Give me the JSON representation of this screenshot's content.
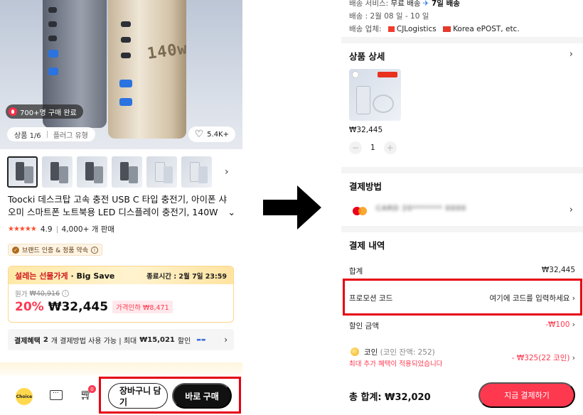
{
  "left": {
    "hero": {
      "brand_text": "140w",
      "sold_badge": "700+명 구매 완료",
      "image_counter": "상품 1/6",
      "variant_tag": "플러그 유형",
      "likes": "5.4K+"
    },
    "product": {
      "title_line1": "Toocki 데스크탑 고속 충전 USB C 타입 충전기, 아이폰 샤",
      "title_line2": "오미 스마트폰 노트북용 LED 디스플레이 충전기, 140W",
      "rating": "4.9",
      "sold": "4,000+ 개 판매",
      "stars": "★★★★★",
      "certification": "브랜드 인증 & 정품 약속"
    },
    "big_save": {
      "label_kr": "설레는 선물가게",
      "label_en": "Big Save",
      "end_time": "종료시간 : 2월 7일 23:59",
      "orig_label": "원가",
      "orig_price": "₩40,916",
      "discount_pct": "20%",
      "price": "₩32,445",
      "price_drop": "가격인하 ₩8,471"
    },
    "benefit": {
      "title": "결제혜택",
      "text_prefix": "2",
      "text": "개 결제방법 사용 가능 | 최대",
      "max": "₩15,021",
      "suffix": "할인"
    },
    "bottom_nav": {
      "choice_label": "Choice",
      "cart_count": "0",
      "add_to_cart": "장바구니 담기",
      "buy_now": "바로 구매"
    }
  },
  "right": {
    "shipping": {
      "service_label": "배송 서비스:",
      "service_value": "무료 배송",
      "speed": "7일 배송",
      "date": "배송 : 2월 08 일 - 10 일",
      "carrier_label": "배송 업체:",
      "carrier1": "CJLogistics",
      "carrier2": "Korea ePOST, etc."
    },
    "item_detail": {
      "title": "상품 상세",
      "price": "₩32,445",
      "quantity": "1",
      "minus": "−",
      "plus": "+"
    },
    "payment_method": {
      "title": "결제방법",
      "card_masked": "CARD 20******* 0000"
    },
    "payment_summary": {
      "title": "결제 내역",
      "subtotal_label": "합계",
      "subtotal_value": "₩32,445",
      "promo_label": "프로모션 코드",
      "promo_value": "여기에 코드를 입력하세요",
      "discount_label": "할인 금액",
      "discount_value": "-₩100",
      "coin_label": "코인",
      "coin_balance": "(코인 잔액: 252)",
      "coin_value": "- ₩325(22 코인)",
      "coin_note": "최대 추가 혜택이 적용되었습니다"
    },
    "footer": {
      "total_label": "총 합계:",
      "total_value": "₩32,020",
      "pay_button": "지금 결제하기"
    }
  },
  "colors": {
    "accent_red": "#fd384f",
    "highlight_red": "#e60012",
    "big_save_yellow": "#ffd68a"
  }
}
